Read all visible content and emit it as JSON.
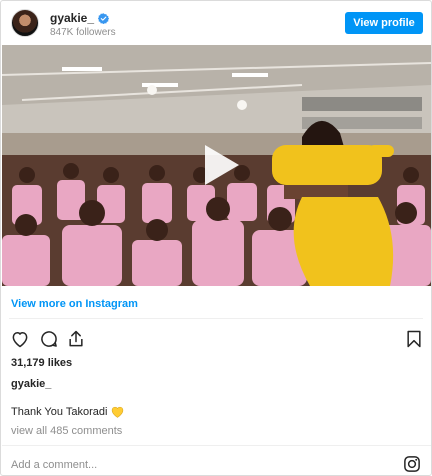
{
  "profile": {
    "username": "gyakie_",
    "followers": "847K followers",
    "view_profile_label": "View profile",
    "verified_icon": "verified-badge-icon",
    "avatar_icon": "avatar"
  },
  "media": {
    "type": "video",
    "play_icon": "play-icon"
  },
  "links": {
    "view_more": "View more on Instagram"
  },
  "actions": {
    "icons": [
      "heart-icon",
      "comment-icon",
      "share-icon",
      "bookmark-icon"
    ]
  },
  "post": {
    "likes": "31,179 likes",
    "caption_user": "gyakie_",
    "caption_text": "Thank You Takoradi",
    "caption_emoji": "yellow-heart-icon",
    "comments": "view all 485 comments"
  },
  "footer": {
    "add_comment_placeholder": "Add a comment...",
    "instagram_icon": "instagram-icon"
  },
  "colors": {
    "accent": "#0095f6",
    "uniform": "#eaa8c4",
    "dress": "#f0c21a"
  }
}
